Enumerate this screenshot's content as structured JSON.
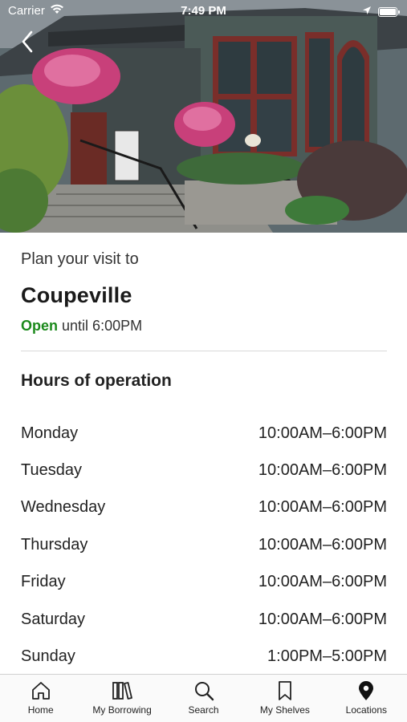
{
  "status_bar": {
    "carrier": "Carrier",
    "time": "7:49 PM"
  },
  "location": {
    "plan_prefix": "Plan your visit to",
    "name": "Coupeville",
    "status": "Open",
    "status_suffix": "until 6:00PM",
    "status_color": "#1c8a1c"
  },
  "hours": {
    "heading": "Hours of operation",
    "rows": [
      {
        "day": "Monday",
        "time": "10:00AM–6:00PM"
      },
      {
        "day": "Tuesday",
        "time": "10:00AM–6:00PM"
      },
      {
        "day": "Wednesday",
        "time": "10:00AM–6:00PM"
      },
      {
        "day": "Thursday",
        "time": "10:00AM–6:00PM"
      },
      {
        "day": "Friday",
        "time": "10:00AM–6:00PM"
      },
      {
        "day": "Saturday",
        "time": "10:00AM–6:00PM"
      },
      {
        "day": "Sunday",
        "time": "1:00PM–5:00PM"
      }
    ]
  },
  "tab_bar": {
    "items": [
      {
        "label": "Home",
        "icon": "home-icon"
      },
      {
        "label": "My Borrowing",
        "icon": "books-icon"
      },
      {
        "label": "Search",
        "icon": "search-icon"
      },
      {
        "label": "My Shelves",
        "icon": "bookmark-icon"
      },
      {
        "label": "Locations",
        "icon": "map-pin-icon"
      }
    ]
  }
}
